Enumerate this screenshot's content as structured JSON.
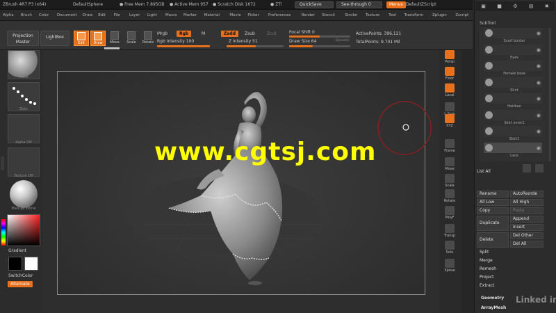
{
  "titlebar": {
    "app": "ZBrush 4R7 P3 (x64)",
    "document": "DefaultSphere",
    "free_mem": "● Free Mem 7.895GB",
    "active_mem": "● Active Mem 957",
    "scratch": "● Scratch Disk 1672",
    "ztime": "● ZTi",
    "quicksave": "QuickSave",
    "see_through": "See-through  0",
    "menus": "Menus",
    "script": "DefaultZScript"
  },
  "menubar": [
    "Alpha",
    "Brush",
    "Color",
    "Document",
    "Draw",
    "Edit",
    "File",
    "Layer",
    "Light",
    "Macro",
    "Marker",
    "Material",
    "Movie",
    "Picker",
    "Preferences",
    "Render",
    "Stencil",
    "Stroke",
    "Texture",
    "Tool",
    "Transform",
    "Zplugin",
    "Zscript"
  ],
  "shelf": {
    "projection_master": "Projection Master",
    "lightbox": "LightBox",
    "tools": [
      {
        "label": "Edit",
        "active": true
      },
      {
        "label": "Draw",
        "active": true
      },
      {
        "label": "Move",
        "active": false
      },
      {
        "label": "Scale",
        "active": false
      },
      {
        "label": "Rotate",
        "active": false
      }
    ],
    "mrgb": "Mrgb",
    "rgb": "Rgb",
    "m": "M",
    "zadd": "Zadd",
    "zsub": "Zsub",
    "zcut": "Zcut",
    "rgb_intensity": "Rgb Intensity 100",
    "z_intensity": "Z Intensity 51",
    "focal_shift": "Focal Shift 0",
    "draw_size": "Draw Size 64",
    "dynamic": "Dynamic",
    "active_points": "ActivePoints: 396,121",
    "total_points": "TotalPoints: 9.701 Mil"
  },
  "left": {
    "brush": "Move",
    "stroke": "Dots",
    "alpha": "Alpha Off",
    "texture": "Texture Off",
    "material": "MatCap White",
    "gradient": "Gradient",
    "switchcolor": "SwitchColor",
    "alternate": "Alternate"
  },
  "nav": [
    {
      "label": "Persp",
      "orange": true
    },
    {
      "label": "Floor",
      "orange": true
    },
    {
      "label": "Local",
      "orange": true
    },
    {
      "label": "L.Sym",
      "orange": false
    },
    {
      "label": "XYZ",
      "orange": true
    },
    {
      "label": "Frame",
      "orange": false
    },
    {
      "label": "Move",
      "orange": false
    },
    {
      "label": "Scale",
      "orange": false
    },
    {
      "label": "Rotate",
      "orange": false
    },
    {
      "label": "PolyF",
      "orange": false
    },
    {
      "label": "Transp",
      "orange": false
    },
    {
      "label": "Solo",
      "orange": false
    },
    {
      "label": "Xpose",
      "orange": false
    }
  ],
  "subtool": {
    "header": "SubTool",
    "items": [
      "Scarf border",
      "Eyes",
      "Female base",
      "Shirt",
      "Hairbun",
      "Skirt inner1",
      "Skirt1",
      "Lace"
    ],
    "list_all": "List All",
    "buttons": {
      "rename": "Rename",
      "autoreorder": "AutoReorde",
      "all_low": "All Low",
      "all_high": "All High",
      "copy": "Copy",
      "paste": "Paste",
      "duplicate": "Duplicate",
      "append": "Append",
      "insert": "Insert",
      "delete": "Delete",
      "del_other": "Del Other",
      "del_all": "Del All",
      "split": "Split",
      "merge": "Merge",
      "remesh": "Remesh",
      "project": "Project",
      "extract": "Extract"
    },
    "geometry": "Geometry",
    "arraymesh": "ArrayMesh"
  },
  "watermark": "www.cgtsj.com",
  "linkedin": "Linked in",
  "colors": {
    "accent": "#e8701c",
    "watermark": "#ffff00"
  }
}
